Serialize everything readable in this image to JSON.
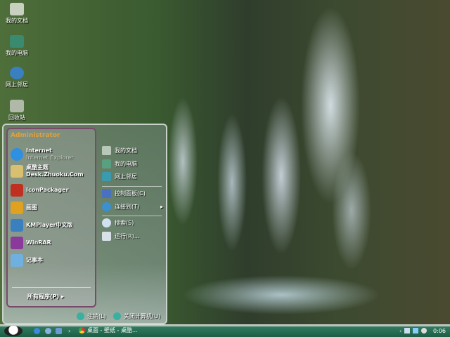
{
  "desktop_icons": [
    {
      "label": "我的文档"
    },
    {
      "label": "我的电脑"
    },
    {
      "label": "网上邻居"
    },
    {
      "label": "回收站"
    }
  ],
  "start_menu": {
    "user": "Administrator",
    "programs": [
      {
        "label": "Internet",
        "sub": "Internet Explorer",
        "icon": "ie-icon",
        "color": "#2f8fe0"
      },
      {
        "label": "桌酷主题",
        "sub": "Desk.Zhuoku.Com",
        "icon": "theme-icon",
        "color": "#d8c070"
      },
      {
        "label": "IconPackager",
        "icon": "iconpackager-icon",
        "color": "#c03020"
      },
      {
        "label": "画图",
        "icon": "paint-icon",
        "color": "#e0a020"
      },
      {
        "label": "KMPlayer中文版",
        "icon": "kmplayer-icon",
        "color": "#3a80c0"
      },
      {
        "label": "WinRAR",
        "icon": "winrar-icon",
        "color": "#8a3a9a"
      },
      {
        "label": "记事本",
        "icon": "notepad-icon",
        "color": "#70b0e0"
      }
    ],
    "all_programs": "所有程序(P)",
    "places": [
      {
        "label": "我的文档",
        "icon": "documents-icon"
      },
      {
        "label": "我的电脑",
        "icon": "computer-icon"
      },
      {
        "label": "网上邻居",
        "icon": "network-icon"
      },
      {
        "label": "控制面板(C)",
        "icon": "control-panel-icon"
      },
      {
        "label": "连接到(T)",
        "icon": "connect-icon",
        "arrow": "▸"
      },
      {
        "label": "搜索(S)",
        "icon": "search-icon"
      },
      {
        "label": "运行(R)...",
        "icon": "run-icon"
      }
    ],
    "logoff": "注销(L)",
    "shutdown": "关闭计算机(U)"
  },
  "taskbar": {
    "task": "桌面 - 壁纸 - 桌酷...",
    "clock": "0:06",
    "chevron": "›"
  }
}
